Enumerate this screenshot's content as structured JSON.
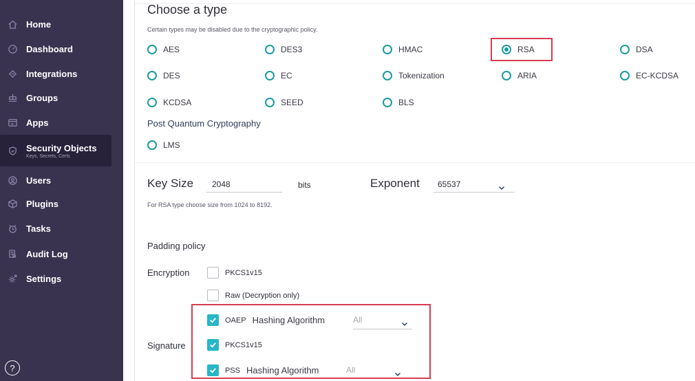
{
  "sidebar": {
    "items": [
      {
        "label": "Home",
        "icon": "home-icon"
      },
      {
        "label": "Dashboard",
        "icon": "dashboard-icon"
      },
      {
        "label": "Integrations",
        "icon": "integrations-icon"
      },
      {
        "label": "Groups",
        "icon": "groups-icon"
      },
      {
        "label": "Apps",
        "icon": "apps-icon"
      },
      {
        "label": "Security Objects",
        "sub": "Keys, Secrets, Certs",
        "icon": "security-objects-icon"
      },
      {
        "label": "Users",
        "icon": "users-icon"
      },
      {
        "label": "Plugins",
        "icon": "plugins-icon"
      },
      {
        "label": "Tasks",
        "icon": "tasks-icon"
      },
      {
        "label": "Audit Log",
        "icon": "audit-log-icon"
      },
      {
        "label": "Settings",
        "icon": "settings-icon"
      }
    ],
    "help_glyph": "?"
  },
  "type_section": {
    "title": "Choose a type",
    "note": "Certain types may be disabled due to the cryptographic policy.",
    "options": [
      "AES",
      "DES3",
      "HMAC",
      "RSA",
      "DSA",
      "DES",
      "EC",
      "Tokenization",
      "ARIA",
      "EC-KCDSA",
      "KCDSA",
      "SEED",
      "BLS"
    ],
    "selected": "RSA",
    "pqc_title": "Post Quantum Cryptography",
    "pqc_options": [
      "LMS"
    ]
  },
  "key": {
    "size_label": "Key Size",
    "size_value": "2048",
    "size_unit": "bits",
    "exponent_label": "Exponent",
    "exponent_value": "65537",
    "note": "For RSA type choose size from 1024 to 8192."
  },
  "padding": {
    "title": "Padding policy",
    "encryption_label": "Encryption",
    "signature_label": "Signature",
    "encryption_options": [
      {
        "label": "PKCS1v15",
        "checked": false
      },
      {
        "label": "Raw (Decryption only)",
        "checked": false
      },
      {
        "label": "OAEP",
        "checked": true,
        "hash_label": "Hashing Algorithm",
        "hash_value": "All"
      }
    ],
    "signature_options": [
      {
        "label": "PKCS1v15",
        "checked": true
      },
      {
        "label": "PSS",
        "checked": true,
        "hash_label": "Hashing Algorithm",
        "hash_value": "All"
      }
    ]
  },
  "colors": {
    "sidebar_bg": "#3a3350",
    "accent": "#1c9a9c",
    "checkbox": "#27b7c6",
    "highlight": "#d63c50"
  }
}
